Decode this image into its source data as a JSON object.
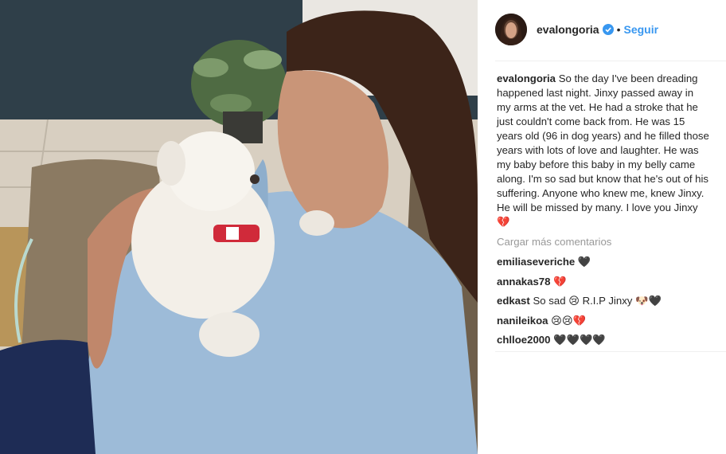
{
  "post": {
    "username": "evalongoria",
    "separator": "•",
    "follow_label": "Seguir",
    "caption_username": "evalongoria",
    "caption_text": "So the day I've been dreading happened last night. Jinxy passed away in my arms at the vet. He had a stroke that he just couldn't come back from. He was 15 years old (96 in dog years) and he filled those years with lots of love and laughter. He was my baby before this baby in my belly came along. I'm so sad but know that he's out of his suffering. Anyone who knew me, knew Jinxy. He will be missed by many. I love you Jinxy 💔",
    "load_more_label": "Cargar más comentarios",
    "photo_icon": "photo-of-woman-holding-white-dog"
  },
  "comments": [
    {
      "user": "emiliaseveriche",
      "text": "🖤"
    },
    {
      "user": "annakas78",
      "text": "💔"
    },
    {
      "user": "edkast",
      "text": "So sad 😢 R.I.P Jinxy 🐶🖤"
    },
    {
      "user": "nanileikoa",
      "text": "😢😢💔"
    },
    {
      "user": "chlloe2000",
      "text": "🖤🖤🖤🖤"
    }
  ],
  "colors": {
    "link_blue": "#3897f0",
    "verified_blue": "#3897f0",
    "muted": "#999999",
    "text": "#262626"
  }
}
